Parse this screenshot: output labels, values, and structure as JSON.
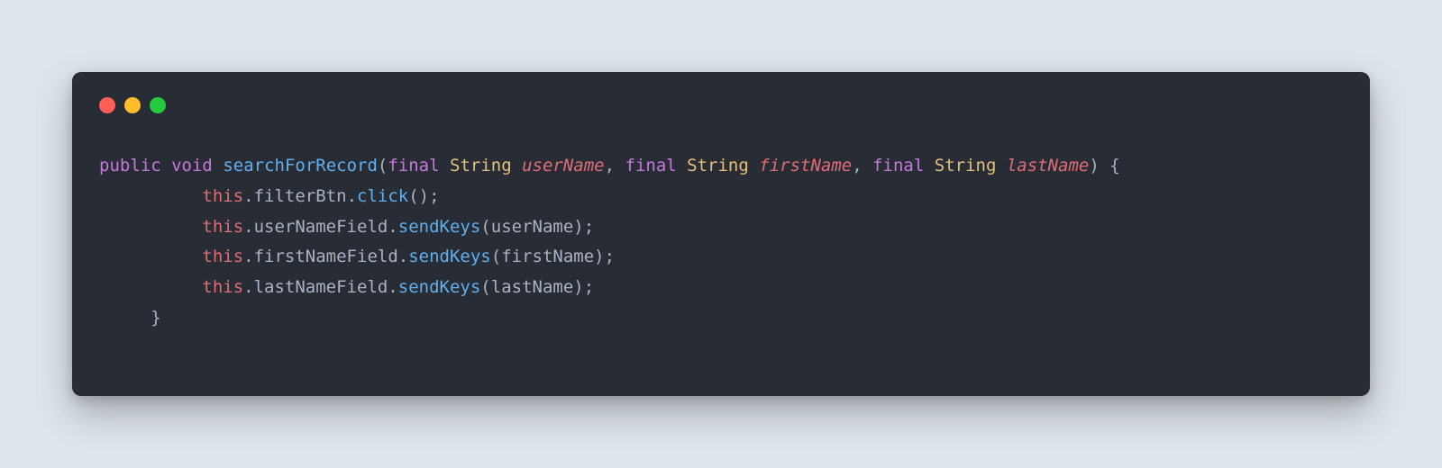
{
  "window": {
    "traffic_lights": {
      "close_color": "#ff5f56",
      "minimize_color": "#ffbd2e",
      "maximize_color": "#27c93f"
    }
  },
  "code": {
    "language": "java",
    "theme": "one-dark",
    "lines": [
      {
        "indent": 0,
        "tokens": [
          {
            "t": "public",
            "c": "keyword"
          },
          {
            "t": " ",
            "c": "punct"
          },
          {
            "t": "void",
            "c": "keyword"
          },
          {
            "t": " ",
            "c": "punct"
          },
          {
            "t": "searchForRecord",
            "c": "method"
          },
          {
            "t": "(",
            "c": "punct"
          },
          {
            "t": "final",
            "c": "keyword"
          },
          {
            "t": " ",
            "c": "punct"
          },
          {
            "t": "String",
            "c": "type"
          },
          {
            "t": " ",
            "c": "punct"
          },
          {
            "t": "userName",
            "c": "param"
          },
          {
            "t": ", ",
            "c": "punct"
          },
          {
            "t": "final",
            "c": "keyword"
          },
          {
            "t": " ",
            "c": "punct"
          },
          {
            "t": "String",
            "c": "type"
          },
          {
            "t": " ",
            "c": "punct"
          },
          {
            "t": "firstName",
            "c": "param"
          },
          {
            "t": ", ",
            "c": "punct"
          },
          {
            "t": "final",
            "c": "keyword"
          },
          {
            "t": " ",
            "c": "punct"
          },
          {
            "t": "String",
            "c": "type"
          },
          {
            "t": " ",
            "c": "punct"
          },
          {
            "t": "lastName",
            "c": "param"
          },
          {
            "t": ") {",
            "c": "punct"
          }
        ]
      },
      {
        "indent": 2,
        "tokens": [
          {
            "t": "this",
            "c": "this"
          },
          {
            "t": ".",
            "c": "punct"
          },
          {
            "t": "filterBtn",
            "c": "property"
          },
          {
            "t": ".",
            "c": "punct"
          },
          {
            "t": "click",
            "c": "call"
          },
          {
            "t": "();",
            "c": "punct"
          }
        ]
      },
      {
        "indent": 2,
        "tokens": [
          {
            "t": "this",
            "c": "this"
          },
          {
            "t": ".",
            "c": "punct"
          },
          {
            "t": "userNameField",
            "c": "property"
          },
          {
            "t": ".",
            "c": "punct"
          },
          {
            "t": "sendKeys",
            "c": "call"
          },
          {
            "t": "(",
            "c": "punct"
          },
          {
            "t": "userName",
            "c": "var"
          },
          {
            "t": ");",
            "c": "punct"
          }
        ]
      },
      {
        "indent": 2,
        "tokens": [
          {
            "t": "this",
            "c": "this"
          },
          {
            "t": ".",
            "c": "punct"
          },
          {
            "t": "firstNameField",
            "c": "property"
          },
          {
            "t": ".",
            "c": "punct"
          },
          {
            "t": "sendKeys",
            "c": "call"
          },
          {
            "t": "(",
            "c": "punct"
          },
          {
            "t": "firstName",
            "c": "var"
          },
          {
            "t": ");",
            "c": "punct"
          }
        ]
      },
      {
        "indent": 2,
        "tokens": [
          {
            "t": "this",
            "c": "this"
          },
          {
            "t": ".",
            "c": "punct"
          },
          {
            "t": "lastNameField",
            "c": "property"
          },
          {
            "t": ".",
            "c": "punct"
          },
          {
            "t": "sendKeys",
            "c": "call"
          },
          {
            "t": "(",
            "c": "punct"
          },
          {
            "t": "lastName",
            "c": "var"
          },
          {
            "t": ");",
            "c": "punct"
          }
        ]
      },
      {
        "indent": 1,
        "tokens": [
          {
            "t": "}",
            "c": "punct"
          }
        ]
      }
    ]
  }
}
